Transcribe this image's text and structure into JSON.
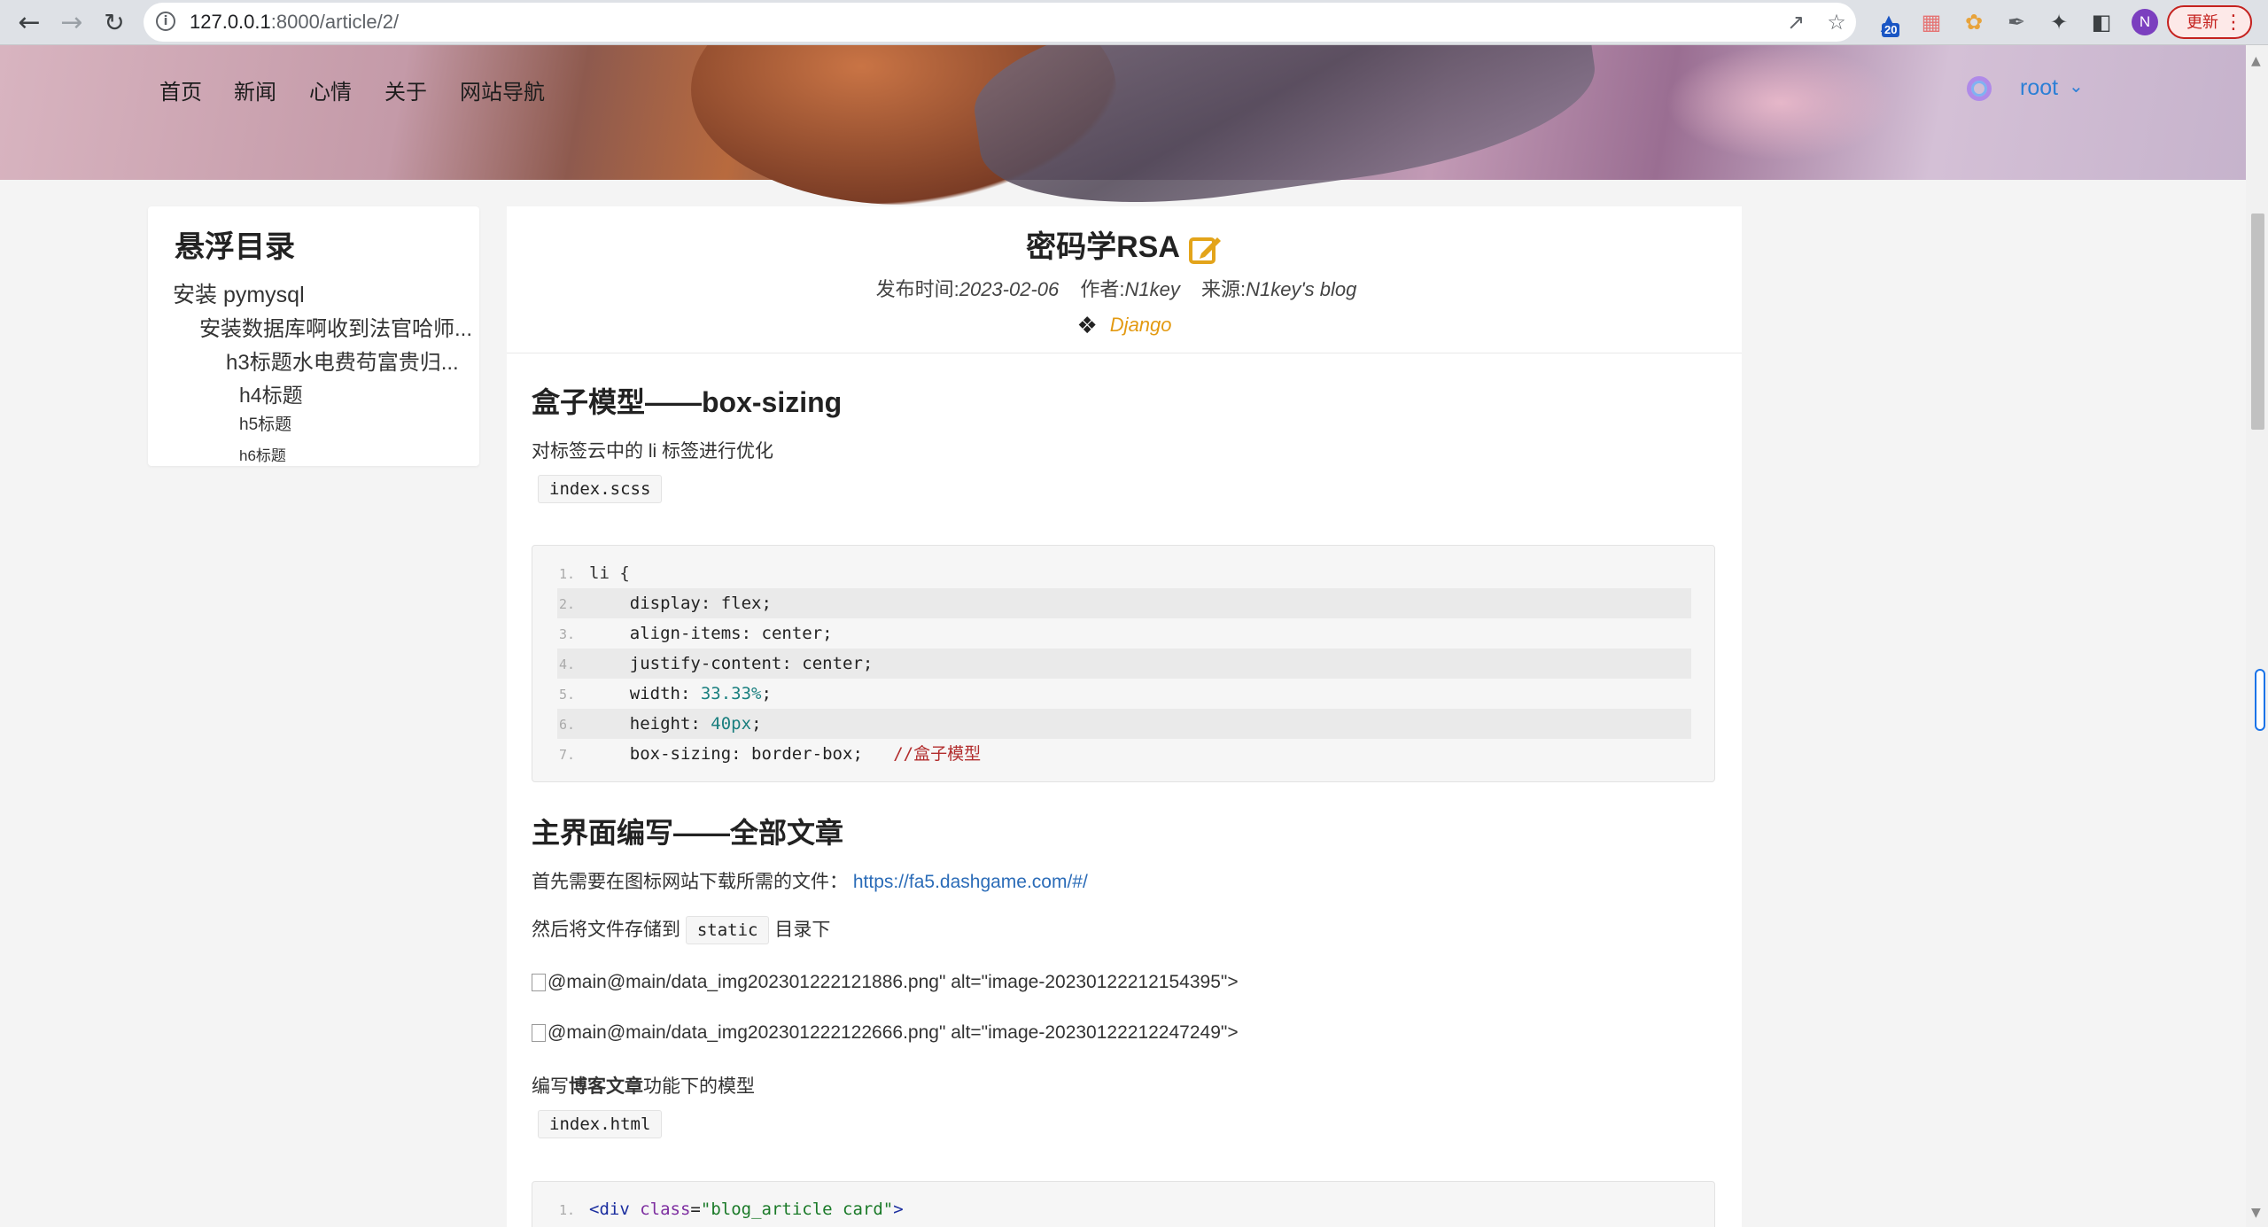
{
  "browser": {
    "url_host": "127.0.0.1",
    "url_path": ":8000/article/2/",
    "avatar_letter": "N",
    "update_label": "更新",
    "extension_badge": "20",
    "icons": [
      "back-icon",
      "forward-icon",
      "reload-icon",
      "site-info-icon",
      "share-icon",
      "bookmark-star-icon",
      "extension-icons",
      "puzzle-icon",
      "side-panel-icon"
    ]
  },
  "site_nav": {
    "items": [
      "首页",
      "新闻",
      "心情",
      "关于",
      "网站导航"
    ],
    "user": "root"
  },
  "toc": {
    "title": "悬浮目录",
    "items": [
      "安装 pymysql",
      "安装数据库啊收到法官哈师...",
      "h3标题水电费苟富贵归...",
      "h4标题",
      "h5标题",
      "h6标题"
    ]
  },
  "article": {
    "title": "密码学RSA",
    "meta_date_label": "发布时间:",
    "meta_date": "2023-02-06",
    "meta_author_label": "作者:",
    "meta_author": "N1key",
    "meta_source_label": "来源:",
    "meta_source": "N1key's blog",
    "tag": "Django",
    "section1_title": "盒子模型——box-sizing",
    "section1_p1": "对标签云中的 li 标签进行优化",
    "section1_file": "index.scss",
    "code1": [
      {
        "n": "1.",
        "sel": "li {",
        "prop": "",
        "val": "",
        "comment": ""
      },
      {
        "n": "2.",
        "sel": "",
        "prop": "display",
        "val": "flex",
        "comment": ""
      },
      {
        "n": "3.",
        "sel": "",
        "prop": "align-items",
        "val": "center",
        "comment": ""
      },
      {
        "n": "4.",
        "sel": "",
        "prop": "justify-content",
        "val": "center",
        "comment": ""
      },
      {
        "n": "5.",
        "sel": "",
        "prop": "width",
        "val": "33.33%",
        "comment": ""
      },
      {
        "n": "6.",
        "sel": "",
        "prop": "height",
        "val": "40px",
        "comment": ""
      },
      {
        "n": "7.",
        "sel": "",
        "prop": "box-sizing",
        "val": "border-box",
        "comment": "//盒子模型"
      }
    ],
    "section2_title": "主界面编写——全部文章",
    "section2_p1": "首先需要在图标网站下载所需的文件：",
    "section2_link": "https://fa5.dashgame.com/#/",
    "section2_p2a": "然后将文件存储到",
    "section2_p2_code": "static",
    "section2_p2b": "目录下",
    "img1": "@main@main/data_img202301222121886.png\" alt=\"image-20230122212154395\">",
    "img2": "@main@main/data_img202301222122666.png\" alt=\"image-20230122212247249\">",
    "section2_p3a": "编写",
    "section2_p3_bold": "博客文章",
    "section2_p3b": "功能下的模型",
    "section2_file": "index.html",
    "code2_line1_n": "1.",
    "code2_line1_open": "<div",
    "code2_line1_attr": "class",
    "code2_line1_val": "\"blog_article card\"",
    "code2_line1_close": ">"
  },
  "colors": {
    "accent_blue": "#2b7fd6",
    "tag_orange": "#e39a12",
    "update_red": "#c5221f"
  }
}
